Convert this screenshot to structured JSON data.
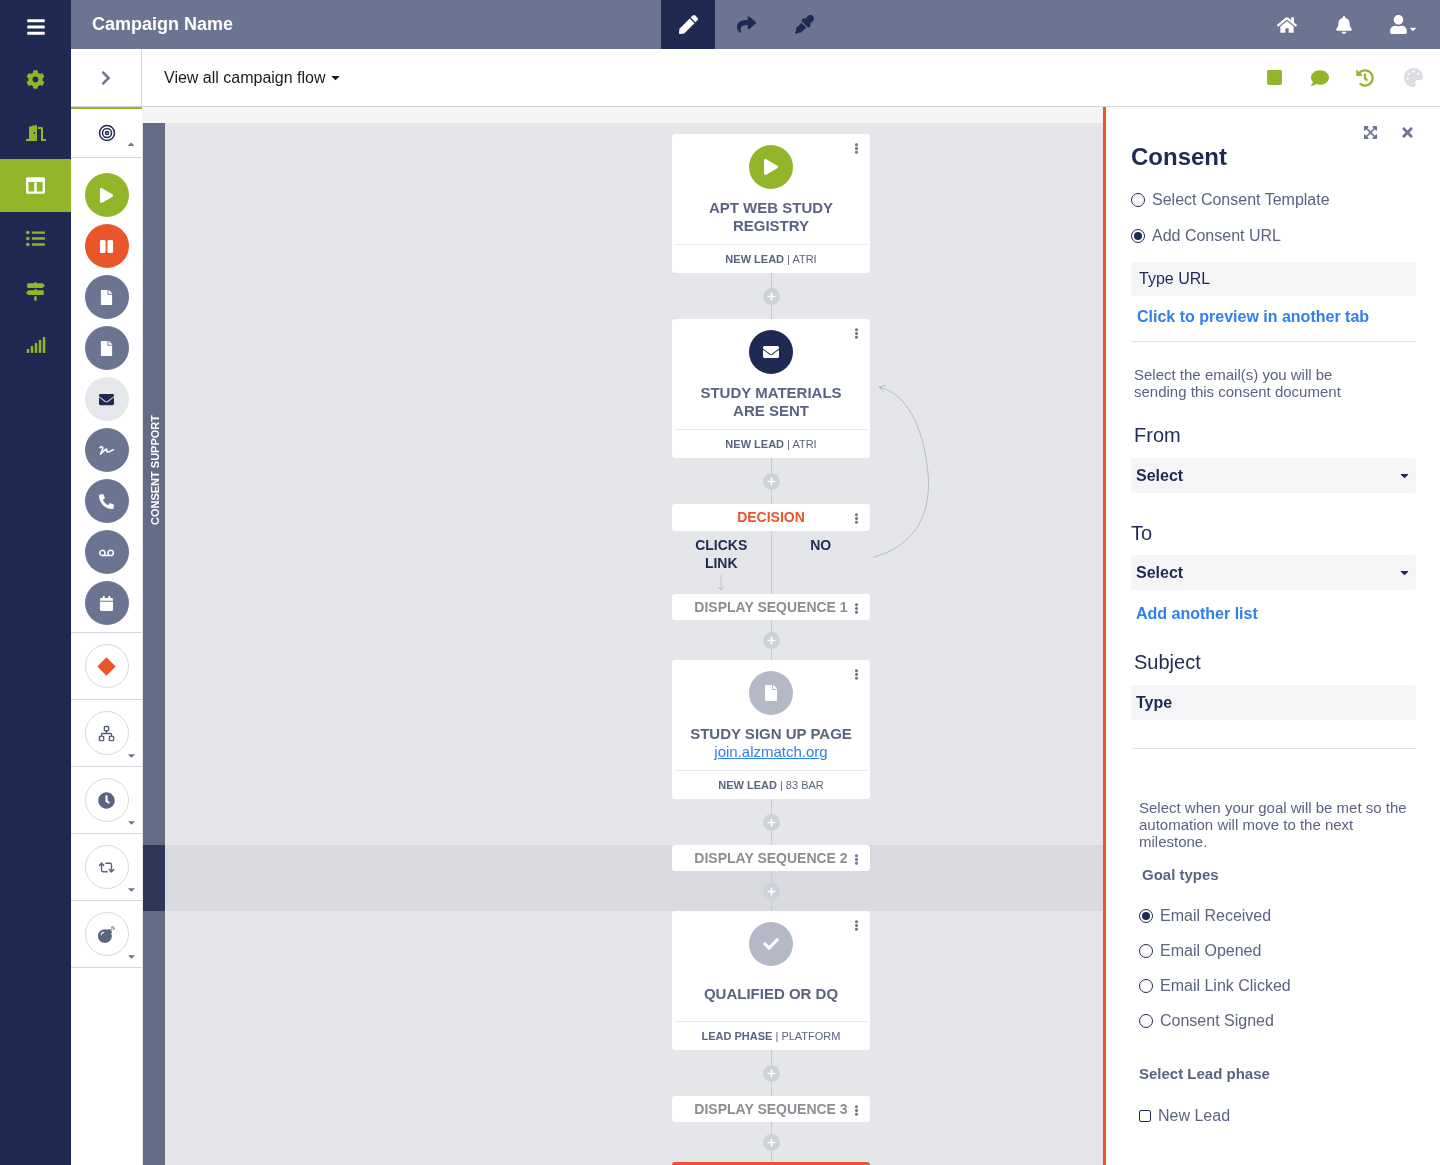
{
  "nav": {
    "items": [
      {
        "kind": "menu",
        "selected": false
      },
      {
        "kind": "settings",
        "selected": false
      },
      {
        "kind": "door",
        "selected": false
      },
      {
        "kind": "layout",
        "selected": true
      },
      {
        "kind": "list",
        "selected": false
      },
      {
        "kind": "signpost",
        "selected": false
      },
      {
        "kind": "signal",
        "selected": false
      }
    ]
  },
  "header": {
    "title": "Campaign Name",
    "tools": [
      {
        "kind": "edit",
        "selected": true
      },
      {
        "kind": "redo",
        "selected": false
      },
      {
        "kind": "eyedropper",
        "selected": false
      }
    ]
  },
  "toolbar": {
    "flow_menu": "View all campaign flow"
  },
  "palette": {
    "goals_expanded": true,
    "steps": [
      {
        "kind": "start"
      },
      {
        "kind": "pause"
      },
      {
        "kind": "page"
      },
      {
        "kind": "page"
      },
      {
        "kind": "email"
      },
      {
        "kind": "signature"
      },
      {
        "kind": "phone"
      },
      {
        "kind": "voicemail"
      },
      {
        "kind": "calendar"
      }
    ],
    "logic": [
      {
        "kind": "decision",
        "has_menu": false
      },
      {
        "kind": "split",
        "has_menu": true
      },
      {
        "kind": "delay",
        "has_menu": true
      },
      {
        "kind": "loop",
        "has_menu": true
      },
      {
        "kind": "bomb",
        "has_menu": true
      }
    ]
  },
  "lane": {
    "label": "CONSENT SUPPORT"
  },
  "flow": {
    "nodes": [
      {
        "kind": "start",
        "title": "APT WEB STUDY REGISTRY",
        "footer": "**NEW LEAD** | ATRI"
      },
      {
        "kind": "email",
        "title": "STUDY MATERIALS ARE SENT",
        "footer": "**NEW LEAD** | ATRI"
      },
      {
        "kind": "decision",
        "title": "DECISION",
        "branches": [
          "CLICKS LINK",
          "NO"
        ]
      },
      {
        "kind": "sequence",
        "title": "DISPLAY SEQUENCE 1",
        "highlighted": false
      },
      {
        "kind": "page",
        "title": "STUDY SIGN UP PAGE",
        "link": "join.alzmatch.org",
        "footer": "**NEW LEAD** | 83 BAR"
      },
      {
        "kind": "sequence",
        "title": "DISPLAY SEQUENCE 2",
        "highlighted": true
      },
      {
        "kind": "milestone",
        "title": "QUALIFIED OR DQ",
        "footer": "**LEAD PHASE** | PLATFORM"
      },
      {
        "kind": "sequence",
        "title": "DISPLAY SEQUENCE 3",
        "highlighted": false
      },
      {
        "kind": "partial"
      }
    ]
  },
  "panel": {
    "title": "Consent",
    "source_options": [
      {
        "label": "Select Consent Template",
        "selected": false
      },
      {
        "label": "Add Consent URL",
        "selected": true
      }
    ],
    "url_field": {
      "placeholder": "Type URL"
    },
    "preview_link": "Click to preview in another tab",
    "email_hint": "Select the email(s) you will be sending this consent document",
    "from": {
      "label": "From",
      "value": "Select"
    },
    "to": {
      "label": "To",
      "value": "Select"
    },
    "add_list_link": "Add another list",
    "subject": {
      "label": "Subject",
      "placeholder": "Type"
    },
    "goal_hint": "Select when your goal will be met so the automation will move to the next milestone.",
    "goal_types_label": "Goal types",
    "goal_types": [
      {
        "label": "Email Received",
        "selected": true
      },
      {
        "label": "Email Opened",
        "selected": false
      },
      {
        "label": "Email Link Clicked",
        "selected": false
      },
      {
        "label": "Consent Signed",
        "selected": false
      }
    ],
    "lead_phase_label": "Select Lead phase",
    "lead_phases": [
      {
        "label": "New Lead",
        "checked": false
      }
    ]
  }
}
